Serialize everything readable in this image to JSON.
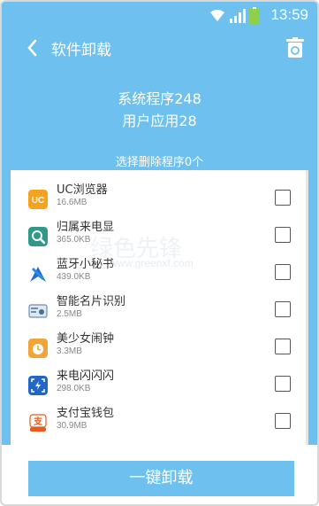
{
  "status_bar": {
    "time": "13:59"
  },
  "header": {
    "title": "软件卸载"
  },
  "summary": {
    "system_apps": "系统程序248",
    "user_apps": "用户应用28",
    "selected": "选择删除程序0个"
  },
  "apps": [
    {
      "name": "UC浏览器",
      "size": "16.6MB",
      "icon": "uc-browser-icon",
      "color": "#f6a21e",
      "checked": false
    },
    {
      "name": "归属来电显",
      "size": "365.0KB",
      "icon": "search-icon",
      "color": "#2f9a8a",
      "checked": false
    },
    {
      "name": "蓝牙小秘书",
      "size": "439.0KB",
      "icon": "bluetooth-icon",
      "color": "#1e6fd1",
      "checked": false
    },
    {
      "name": "智能名片识别",
      "size": "2.5MB",
      "icon": "card-scan-icon",
      "color": "#6f8fb2",
      "checked": false
    },
    {
      "name": "美少女闹钟",
      "size": "3.3MB",
      "icon": "alarm-icon",
      "color": "#f0a43a",
      "checked": false
    },
    {
      "name": "来电闪闪闪",
      "size": "298.0KB",
      "icon": "flash-call-icon",
      "color": "#2166c8",
      "checked": false
    },
    {
      "name": "支付宝钱包",
      "size": "30.9MB",
      "icon": "alipay-icon",
      "color": "#e85a1e",
      "checked": false
    }
  ],
  "actions": {
    "uninstall": "一键卸载"
  },
  "watermark": {
    "text": "绿色先锋",
    "url": "www.greenxf.com"
  }
}
